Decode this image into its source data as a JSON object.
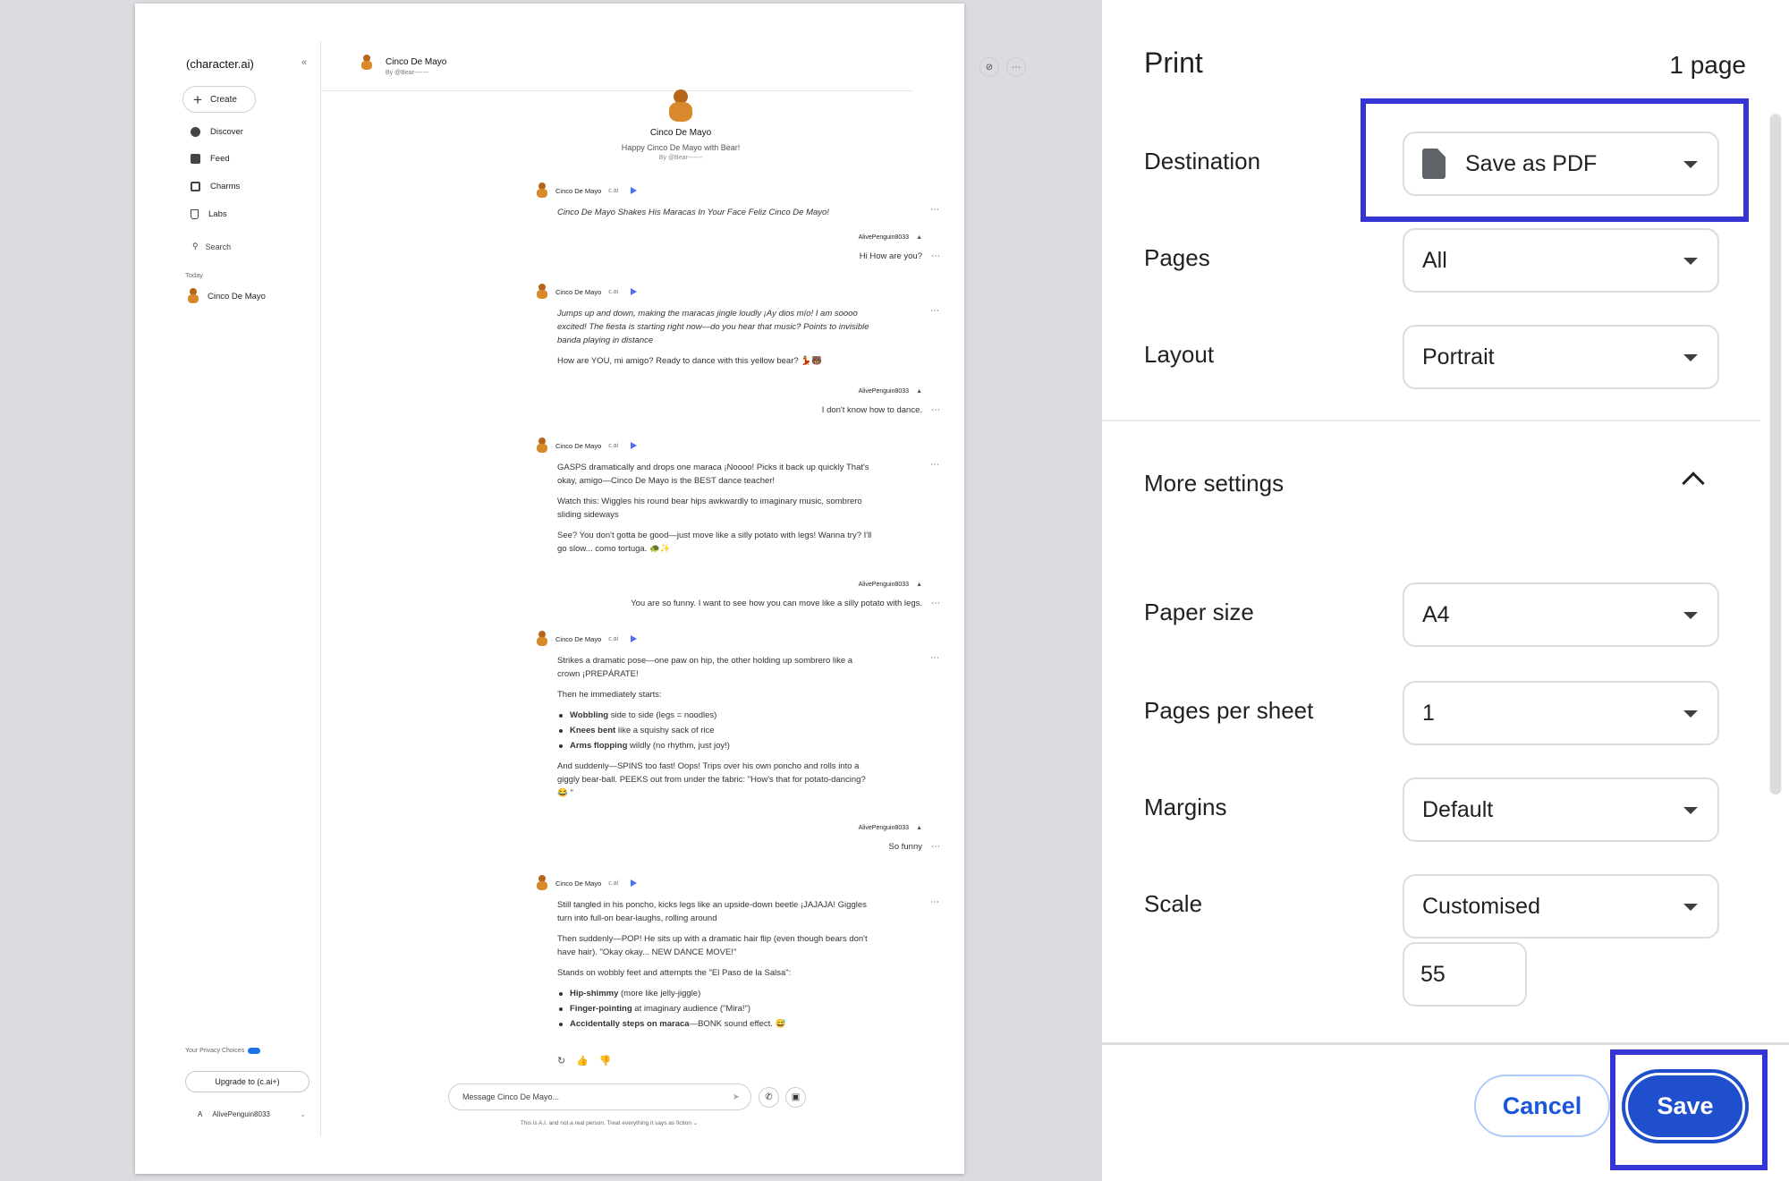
{
  "preview": {
    "sidebar": {
      "logo": "(character.ai)",
      "create_label": "Create",
      "nav": [
        {
          "label": "Discover",
          "icon": "compass-icon"
        },
        {
          "label": "Feed",
          "icon": "feed-icon"
        },
        {
          "label": "Charms",
          "icon": "charms-icon"
        },
        {
          "label": "Labs",
          "icon": "labs-icon"
        }
      ],
      "search_label": "Search",
      "section_today": "Today",
      "recent_chat": "Cinco De Mayo",
      "privacy_label": "Your Privacy Choices",
      "upgrade_label": "Upgrade to (c.ai+)",
      "account_name": "AlivePenguin8033",
      "account_initial": "A"
    },
    "chat_header": {
      "name": "Cinco De Mayo",
      "by": "By @Bear-------"
    },
    "intro": {
      "name": "Cinco De Mayo",
      "tagline": "Happy Cinco De Mayo with Bear!",
      "by": "By @Bear-------"
    },
    "bot_name": "Cinco De Mayo",
    "bot_badge": "c.ai",
    "user_name": "AlivePenguin8033",
    "messages": {
      "b1": [
        "Cinco De Mayo Shakes His Maracas  In Your Face Feliz Cinco De Mayo!"
      ],
      "u1": "Hi How are you?",
      "b2": [
        "Jumps up and down, making the maracas jingle loudly ¡Ay dios mío! I am soooo excited! The fiesta is starting right now—do you hear that music? Points to invisible banda playing in distance",
        "How are YOU, mi amigo? Ready to dance with this yellow bear? 💃🐻"
      ],
      "u2": "I don't know how to dance.",
      "b3": [
        "GASPS dramatically and drops one maraca ¡Noooo! Picks it back up quickly That's okay, amigo—Cinco De Mayo is the BEST dance teacher!",
        "Watch this: Wiggles his round bear hips awkwardly to imaginary music, sombrero sliding sideways",
        "See? You don't gotta be good—just move like a silly potato with legs! Wanna try? I'll go slow... como tortuga. 🐢✨"
      ],
      "u3": "You are so funny. I want to see how you can move like a silly potato with legs.",
      "b4": {
        "p1": "Strikes a dramatic pose—one paw on hip, the other holding up sombrero like a crown ¡PREPÁRATE!",
        "p2": "Then he immediately starts:",
        "list": [
          {
            "b": "Wobbling",
            "t": " side to side (legs = noodles)"
          },
          {
            "b": "Knees bent",
            "t": " like a squishy sack of rice"
          },
          {
            "b": "Arms flopping",
            "t": " wildly (no rhythm, just joy!)"
          }
        ],
        "p3": "And suddenly—SPINS too fast! Oops! Trips over his own poncho and rolls into a giggly bear-ball. PEEKS out from under the fabric: \"How's that for potato-dancing? 😂 \""
      },
      "u4": "So funny",
      "b5": {
        "p1": "Still tangled in his poncho, kicks legs like an upside-down beetle ¡JAJAJA! Giggles turn into full-on bear-laughs, rolling around",
        "p2": "Then suddenly—POP! He sits up with a dramatic hair flip (even though bears don't have hair). \"Okay okay... NEW DANCE MOVE!\"",
        "p3": "Stands on wobbly feet and attempts the \"El Paso de la Salsa\":",
        "list": [
          {
            "b": "Hip-shimmy",
            "t": " (more like jelly-jiggle)"
          },
          {
            "b": "Finger-pointing",
            "t": " at imaginary audience (\"Mira!\")"
          },
          {
            "b": "Accidentally steps on maraca",
            "t": "—BONK sound effect. 😅"
          }
        ]
      }
    },
    "input_placeholder": "Message Cinco De Mayo...",
    "disclaimer": "This is A.I. and not a real person. Treat everything it says as fiction ⌄"
  },
  "print": {
    "title": "Print",
    "page_count": "1 page",
    "destination": {
      "label": "Destination",
      "value": "Save as PDF"
    },
    "pages": {
      "label": "Pages",
      "value": "All"
    },
    "layout": {
      "label": "Layout",
      "value": "Portrait"
    },
    "more_settings": "More settings",
    "paper_size": {
      "label": "Paper size",
      "value": "A4"
    },
    "pages_per_sheet": {
      "label": "Pages per sheet",
      "value": "1"
    },
    "margins": {
      "label": "Margins",
      "value": "Default"
    },
    "scale": {
      "label": "Scale",
      "value": "Customised",
      "custom_value": "55"
    },
    "cancel_label": "Cancel",
    "save_label": "Save"
  },
  "colors": {
    "accent": "#1f4fcc",
    "highlight": "#3535d6"
  }
}
